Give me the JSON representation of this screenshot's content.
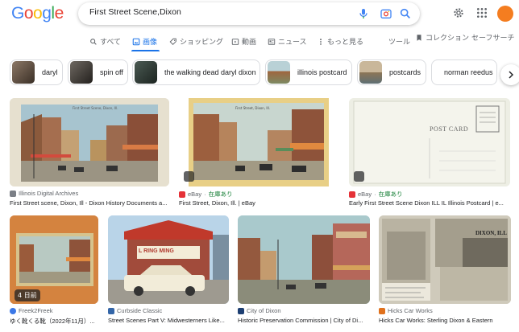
{
  "header": {
    "logo": "Google",
    "logo_colors": [
      "#4285f4",
      "#ea4335",
      "#fbbc05",
      "#4285f4",
      "#34a853",
      "#ea4335"
    ],
    "search_value": "First Street Scene,Dixon"
  },
  "tabs": [
    {
      "label": "すべて",
      "icon": "search-icon",
      "active": false
    },
    {
      "label": "画像",
      "icon": "image-icon",
      "active": true
    },
    {
      "label": "ショッピング",
      "icon": "tag-icon",
      "active": false
    },
    {
      "label": "動画",
      "icon": "play-icon",
      "active": false
    },
    {
      "label": "ニュース",
      "icon": "news-icon",
      "active": false
    },
    {
      "label": "もっと見る",
      "icon": "more-vert-icon",
      "active": false
    }
  ],
  "tools": {
    "tools_label": "ツール",
    "collections_label": "コレクション",
    "safesearch_label": "セーフサーチ"
  },
  "chips": [
    {
      "label": "daryl",
      "thumb_color": "#5a4b3c"
    },
    {
      "label": "spin off",
      "thumb_color": "#3d3a36"
    },
    {
      "label": "the walking dead daryl dixon",
      "thumb_color": "#2d3a35"
    },
    {
      "label": "illinois postcard",
      "thumb_color": "#8aa4a9"
    },
    {
      "label": "postcards",
      "thumb_color": "#b7a58c"
    },
    {
      "label": "norman reedus",
      "thumb_color": "#ffffff"
    }
  ],
  "results": [
    {
      "source": "Illinois Digital Archives",
      "stock": "",
      "title": "First Street scene, Dixon, Ill - Dixon History Documents a...",
      "fav": "#7b7f86"
    },
    {
      "source": "eBay",
      "stock": "在庫あり",
      "title": "First Street, Dixon, Ill. | eBay",
      "fav": "#e53238"
    },
    {
      "source": "eBay",
      "stock": "在庫あり",
      "title": "Early First Street Scene Dixon ILL IL Illinois Postcard | e...",
      "fav": "#e53238"
    },
    {
      "source": "Freek2Freek",
      "stock": "",
      "title": "ゆく靴くる靴（2022年11月）...",
      "fav": "#3b78e7",
      "badge": "4 日前"
    },
    {
      "source": "Curbside Classic",
      "stock": "",
      "title": "Street Scenes Part V: Midwesterners Like...",
      "fav": "#3466a8"
    },
    {
      "source": "City of Dixon",
      "stock": "",
      "title": "Historic Preservation Commission | City of Di...",
      "fav": "#1d3f72"
    },
    {
      "source": "Hicks Car Works",
      "stock": "",
      "title": "Hicks Car Works: Sterling Dixon & Eastern",
      "fav": "#e0711c"
    }
  ],
  "images": {
    "postcard_back_text": "POST CARD",
    "dixon_sign": "DIXON, ILL",
    "lunch_sign": "L RING MING"
  }
}
